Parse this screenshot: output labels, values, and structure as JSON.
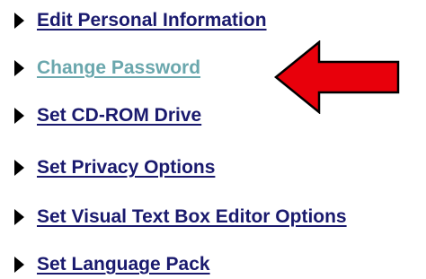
{
  "menu": {
    "items": [
      {
        "label": "Edit Personal Information",
        "visited": false
      },
      {
        "label": "Change Password",
        "visited": true
      },
      {
        "label": "Set CD-ROM Drive",
        "visited": false
      },
      {
        "label": "Set Privacy Options",
        "visited": false
      },
      {
        "label": "Set Visual Text Box Editor Options",
        "visited": false
      },
      {
        "label": "Set Language Pack",
        "visited": false
      }
    ]
  },
  "colors": {
    "link": "#1a1a6e",
    "visited_link": "#6aa7ad",
    "bullet": "#000000",
    "arrow_fill": "#e8000b",
    "arrow_stroke": "#000000"
  },
  "icons": {
    "bullet": "triangle-right-icon",
    "callout": "red-arrow-left-icon"
  }
}
